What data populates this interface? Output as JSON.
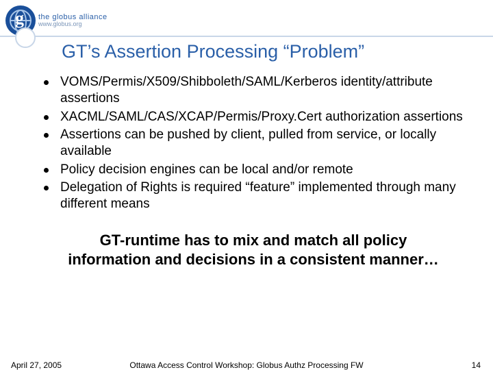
{
  "logo": {
    "line1": "the globus alliance",
    "line2": "www.globus.org",
    "glyph": "g"
  },
  "title": "GT’s Assertion Processing “Problem”",
  "bullets": [
    "VOMS/Permis/X509/Shibboleth/SAML/Kerberos identity/attribute assertions",
    "XACML/SAML/CAS/XCAP/Permis/Proxy.Cert authorization assertions",
    "Assertions can be pushed by client, pulled from service, or locally available",
    "Policy decision engines can be local and/or remote",
    "Delegation of Rights is required “feature” implemented through many different means"
  ],
  "summary": "GT-runtime has to mix and match all policy information and decisions in a consistent manner…",
  "footer": {
    "date": "April 27, 2005",
    "title": "Ottawa Access Control Workshop: Globus Authz Processing FW",
    "page": "14"
  }
}
